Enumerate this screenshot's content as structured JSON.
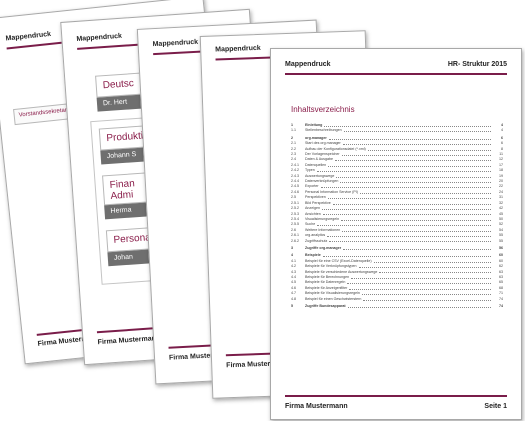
{
  "header_title": "Mappendruck",
  "header_right": "HR- Struktur 2015",
  "footer_company": "Firma Mustermann",
  "footer_page": "Seite 1",
  "footer_company_truncated": "Firma Muster",
  "org": {
    "side_box": "Vorstandssekretariat",
    "side_box_trunc": "Vorstandssekret",
    "top_title": "Deutsc",
    "top_person": "Dr. Hert",
    "prod_title": "Produktion",
    "prod_person": "Johann S",
    "fin_title1": "Finan",
    "fin_title2": "Admi",
    "fin_person": "Herma",
    "pers_title": "Personal",
    "pers_person": "Johan"
  },
  "toc_title": "Inhaltsverzeichnis",
  "toc": [
    {
      "num": "1",
      "text": "Einleitung",
      "page": "4",
      "level": 1
    },
    {
      "num": "1.1",
      "text": "Stellenbeschreibungen",
      "page": "4",
      "level": 2
    },
    {
      "num": "2",
      "text": "org.manager",
      "page": "6",
      "level": 1
    },
    {
      "num": "2.1",
      "text": "Start des org.manager",
      "page": "6",
      "level": 2
    },
    {
      "num": "2.2",
      "text": "Aufbau der Konfigurationsdatei (*.xml)",
      "page": "8",
      "level": 2
    },
    {
      "num": "2.3",
      "text": "Der Vorlagenspeicher",
      "page": "11",
      "level": 2
    },
    {
      "num": "2.4",
      "text": "Daten & Ausgabe",
      "page": "12",
      "level": 2
    },
    {
      "num": "2.4.1",
      "text": "Datenquellen",
      "page": "17",
      "level": 3
    },
    {
      "num": "2.4.2",
      "text": "Typen",
      "page": "18",
      "level": 3
    },
    {
      "num": "2.4.3",
      "text": "Auswertungswege",
      "page": "19",
      "level": 3
    },
    {
      "num": "2.4.4",
      "text": "Datenverknüpfungen",
      "page": "20",
      "level": 3
    },
    {
      "num": "2.4.5",
      "text": "Exporter",
      "page": "22",
      "level": 3
    },
    {
      "num": "2.4.6",
      "text": "Personal Information Service (PI)",
      "page": "24",
      "level": 3
    },
    {
      "num": "2.5",
      "text": "Perspektiven",
      "page": "31",
      "level": 2
    },
    {
      "num": "2.5.1",
      "text": "Bild Perspektive",
      "page": "32",
      "level": 3
    },
    {
      "num": "2.5.2",
      "text": "Anzeigen",
      "page": "42",
      "level": 3
    },
    {
      "num": "2.5.3",
      "text": "Ansichten",
      "page": "45",
      "level": 3
    },
    {
      "num": "2.5.4",
      "text": "Visualisierungsregeln",
      "page": "50",
      "level": 3
    },
    {
      "num": "2.5.5",
      "text": "Suche",
      "page": "52",
      "level": 3
    },
    {
      "num": "2.6",
      "text": "Weitere Informationen",
      "page": "54",
      "level": 2
    },
    {
      "num": "2.6.1",
      "text": "org.analytics",
      "page": "55",
      "level": 3
    },
    {
      "num": "2.6.2",
      "text": "Zugriffsschutz",
      "page": "55",
      "level": 3
    },
    {
      "num": "3",
      "text": "Zugriffe org.manager",
      "page": "56",
      "level": 1
    },
    {
      "num": "4",
      "text": "Beispiele",
      "page": "60",
      "level": 1
    },
    {
      "num": "4.1",
      "text": "Beispiel für eine CSV (Excel-Datenquelle)",
      "page": "60",
      "level": 2
    },
    {
      "num": "4.2",
      "text": "Beispiele für Verknüpfungstypen",
      "page": "62",
      "level": 2
    },
    {
      "num": "4.3",
      "text": "Beispiele für verschiedene Auswertungswege",
      "page": "63",
      "level": 2
    },
    {
      "num": "4.4",
      "text": "Beispiele für Berechnungen",
      "page": "63",
      "level": 2
    },
    {
      "num": "4.5",
      "text": "Beispiele für Datenregeln",
      "page": "65",
      "level": 2
    },
    {
      "num": "4.6",
      "text": "Beispiele für Anzeigenfilter",
      "page": "68",
      "level": 2
    },
    {
      "num": "4.7",
      "text": "Beispiele für Visualisierungsregeln",
      "page": "71",
      "level": 2
    },
    {
      "num": "4.8",
      "text": "Beispiel für einen Geschwisterstern",
      "page": "74",
      "level": 2
    },
    {
      "num": "5",
      "text": "Zugriffe Bundesapparat",
      "page": "74",
      "level": 1
    }
  ]
}
